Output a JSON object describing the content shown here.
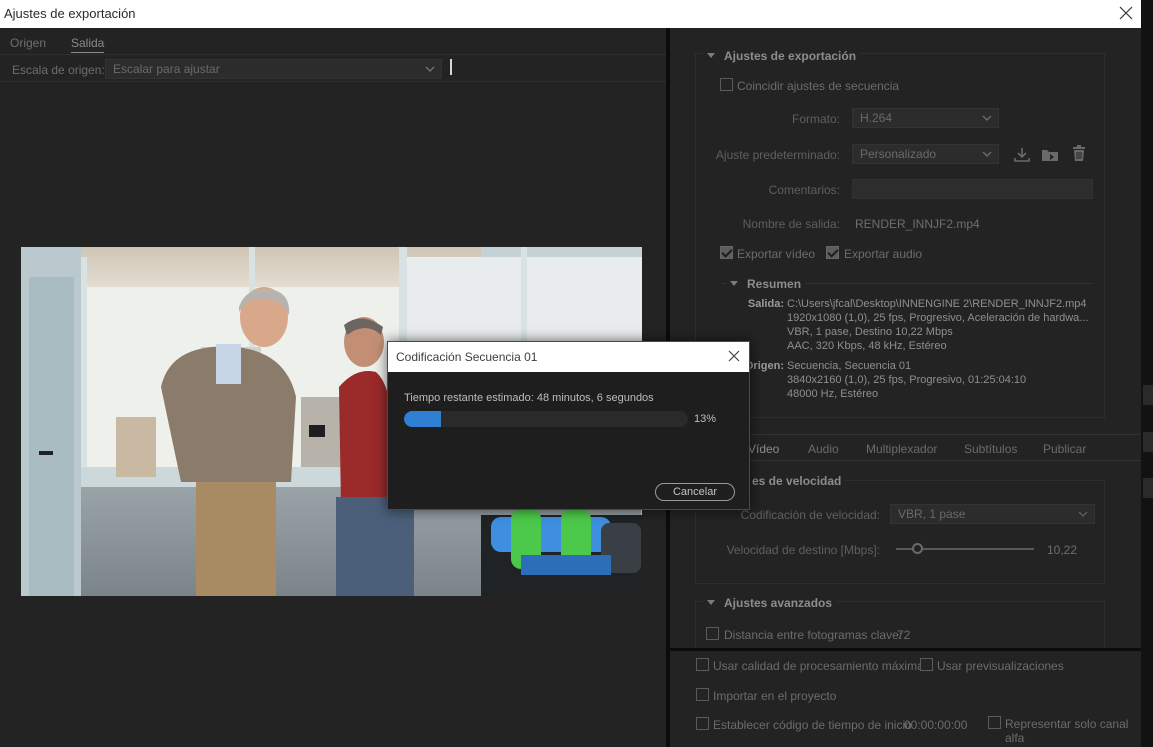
{
  "window": {
    "title": "Ajustes de exportación"
  },
  "left": {
    "tabs": [
      "Origen",
      "Salida"
    ],
    "scale_label": "Escala de origen:",
    "scale_value": "Escalar para ajustar"
  },
  "export": {
    "header": "Ajustes de exportación",
    "match_sequence": "Coincidir ajustes de secuencia",
    "format_label": "Formato:",
    "format_value": "H.264",
    "preset_label": "Ajuste predeterminado:",
    "preset_value": "Personalizado",
    "comments_label": "Comentarios:",
    "output_label": "Nombre de salida:",
    "output_value": "RENDER_INNJF2.mp4",
    "export_video": "Exportar vídeo",
    "export_audio": "Exportar audio"
  },
  "summary": {
    "header": "Resumen",
    "output_key": "Salida:",
    "output_lines": [
      "C:\\Users\\jfcal\\Desktop\\INNENGINE 2\\RENDER_INNJF2.mp4",
      "1920x1080 (1,0), 25 fps, Progresivo,  Aceleración de hardwa...",
      "VBR, 1 pase, Destino 10,22 Mbps",
      "AAC, 320 Kbps, 48 kHz, Estéreo"
    ],
    "source_key": "Origen:",
    "source_lines": [
      "Secuencia, Secuencia 01",
      "3840x2160 (1,0), 25 fps, Progresivo, 01:25:04:10",
      "48000 Hz, Estéreo"
    ]
  },
  "subtabs": [
    "Vídeo",
    "Audio",
    "Multiplexador",
    "Subtítulos",
    "Publicar"
  ],
  "bitrate": {
    "header": "es de velocidad",
    "encoding_label": "Codificación de velocidad:",
    "encoding_value": "VBR, 1 pase",
    "target_label": "Velocidad de destino [Mbps]:",
    "target_value": "10,22"
  },
  "advanced": {
    "header": "Ajustes avanzados",
    "keyframe_label": "Distancia entre fotogramas clave:",
    "keyframe_value": "72"
  },
  "bottom": {
    "max_quality": "Usar calidad de procesamiento máxima",
    "use_previews": "Usar previsualizaciones",
    "import_project": "Importar en el proyecto",
    "set_timecode": "Establecer código de tiempo de inicio",
    "timecode_value": "00:00:00:00",
    "alpha_only": "Representar solo canal alfa"
  },
  "modal": {
    "title": "Codificación Secuencia 01",
    "message": "Tiempo restante estimado: 48 minutos, 6 segundos",
    "percent_text": "13%",
    "progress": 0.13,
    "cancel_label": "Cancelar"
  },
  "colors": {
    "accent": "#2f7fd4"
  }
}
